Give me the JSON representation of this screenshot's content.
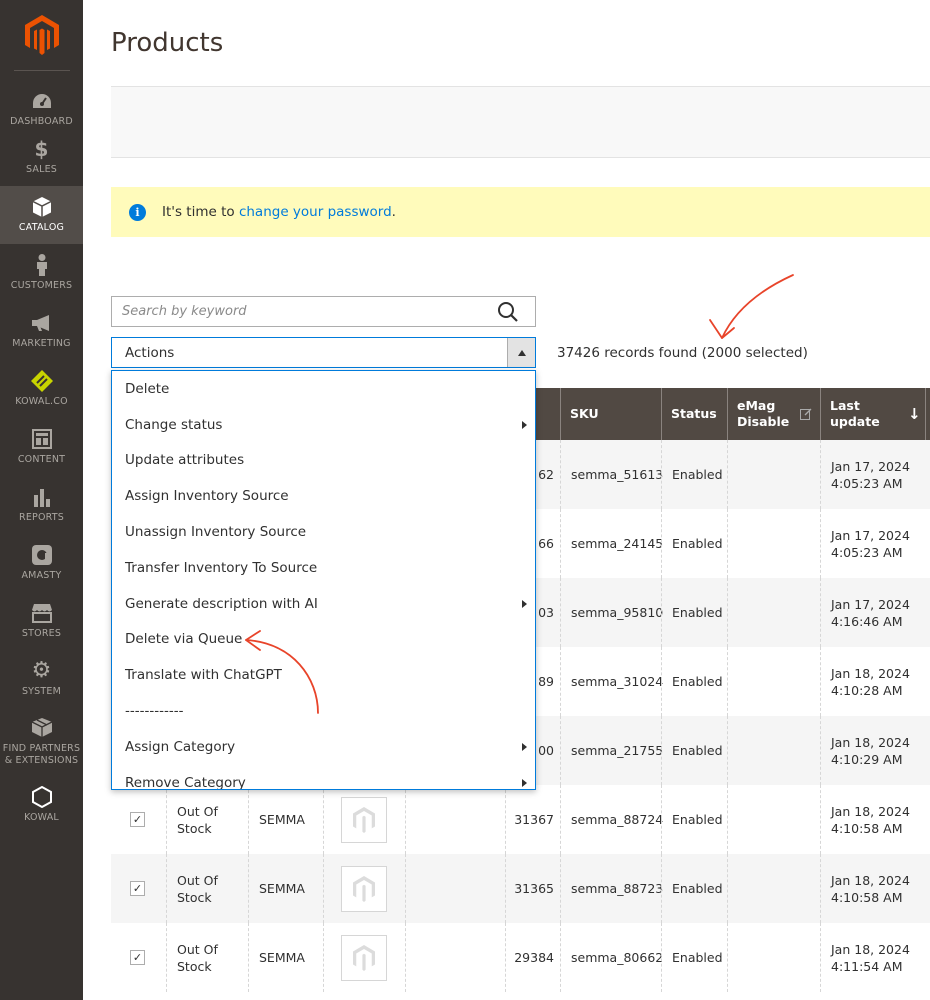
{
  "sidebar": {
    "items": [
      {
        "label": "DASHBOARD",
        "icon": "dashboard-icon"
      },
      {
        "label": "SALES",
        "icon": "dollar-icon"
      },
      {
        "label": "CATALOG",
        "icon": "cube-icon",
        "active": true
      },
      {
        "label": "CUSTOMERS",
        "icon": "person-icon"
      },
      {
        "label": "MARKETING",
        "icon": "megaphone-icon"
      },
      {
        "label": "KOWAL.CO",
        "icon": "diamond-icon"
      },
      {
        "label": "CONTENT",
        "icon": "layout-icon"
      },
      {
        "label": "REPORTS",
        "icon": "bar-chart-icon"
      },
      {
        "label": "AMASTY",
        "icon": "amasty-icon"
      },
      {
        "label": "STORES",
        "icon": "store-icon"
      },
      {
        "label": "SYSTEM",
        "icon": "gear-icon"
      },
      {
        "label": "FIND PARTNERS & EXTENSIONS",
        "icon": "boxes-icon"
      },
      {
        "label": "KOWAL",
        "icon": "hexagon-icon"
      }
    ]
  },
  "page": {
    "title": "Products"
  },
  "notice": {
    "text_before": "It's time to ",
    "link": "change your password",
    "text_after": "."
  },
  "search": {
    "placeholder": "Search by keyword",
    "value": ""
  },
  "actions": {
    "label": "Actions"
  },
  "records": {
    "text": "37426 records found (2000 selected)"
  },
  "dropdown": {
    "items": [
      {
        "label": "Delete",
        "submenu": false
      },
      {
        "label": "Change status",
        "submenu": true
      },
      {
        "label": "Update attributes",
        "submenu": false
      },
      {
        "label": "Assign Inventory Source",
        "submenu": false
      },
      {
        "label": "Unassign Inventory Source",
        "submenu": false
      },
      {
        "label": "Transfer Inventory To Source",
        "submenu": false
      },
      {
        "label": "Generate description with AI",
        "submenu": true
      },
      {
        "label": "Delete via Queue",
        "submenu": false
      },
      {
        "label": "Translate with ChatGPT",
        "submenu": false
      },
      {
        "label": "------------",
        "submenu": false
      },
      {
        "label": "Assign Category",
        "submenu": true
      },
      {
        "label": "Remove Category",
        "submenu": true
      }
    ]
  },
  "grid": {
    "headers": {
      "sku": "SKU",
      "status": "Status",
      "emag": "eMag Disable",
      "last_update": "Last update"
    },
    "rows": [
      {
        "id": "62",
        "sku": "semma_51613",
        "status": "Enabled",
        "date": "Jan 17, 2024",
        "time": "4:05:23 AM"
      },
      {
        "id": "66",
        "sku": "semma_24145",
        "status": "Enabled",
        "date": "Jan 17, 2024",
        "time": "4:05:23 AM"
      },
      {
        "id": "03",
        "sku": "semma_95810",
        "status": "Enabled",
        "date": "Jan 17, 2024",
        "time": "4:16:46 AM"
      },
      {
        "id": "89",
        "sku": "semma_31024",
        "status": "Enabled",
        "date": "Jan 18, 2024",
        "time": "4:10:28 AM"
      },
      {
        "id": "00",
        "sku": "semma_21755",
        "status": "Enabled",
        "date": "Jan 18, 2024",
        "time": "4:10:29 AM"
      },
      {
        "stock": "Out Of Stock",
        "brand": "SEMMA",
        "id": "31367",
        "sku": "semma_88724",
        "status": "Enabled",
        "date": "Jan 18, 2024",
        "time": "4:10:58 AM"
      },
      {
        "stock": "Out Of Stock",
        "brand": "SEMMA",
        "id": "31365",
        "sku": "semma_88723",
        "status": "Enabled",
        "date": "Jan 18, 2024",
        "time": "4:10:58 AM"
      },
      {
        "stock": "Out Of Stock",
        "brand": "SEMMA",
        "id": "29384",
        "sku": "semma_80662",
        "status": "Enabled",
        "date": "Jan 18, 2024",
        "time": "4:11:54 AM"
      }
    ]
  },
  "colors": {
    "accent": "#eb5202",
    "link": "#007bdb",
    "sidebar": "#373330",
    "header": "#514943",
    "notice": "#fffbbb",
    "annotation": "#e8442a"
  }
}
